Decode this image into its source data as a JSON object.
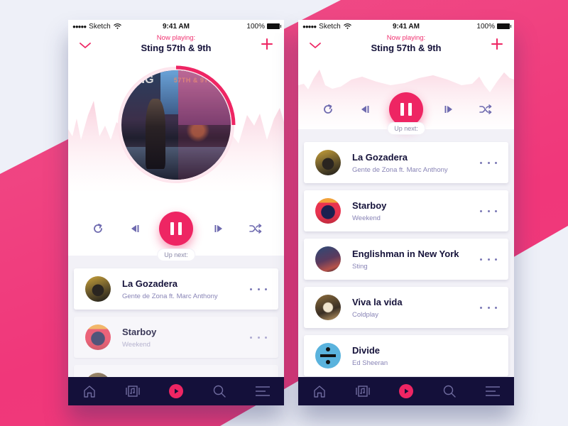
{
  "colors": {
    "accent": "#ee2563",
    "dark_nav": "#14103a",
    "title_text": "#15123a",
    "secondary_text": "#8884b6",
    "icon": "#7b78b5",
    "background_band": "#f0377a",
    "background": "#eef0f8"
  },
  "status_bar": {
    "carrier": "Sketch",
    "signal_dots": "●●●●●",
    "time": "9:41 AM",
    "battery": "100%"
  },
  "header": {
    "now_playing_label": "Now playing:",
    "track_title": "Sting 57th & 9th",
    "collapse_icon": "chevron-down-icon",
    "add_icon": "plus-icon"
  },
  "album_art": {
    "title_overlay": "57TH & 9TH",
    "name_overlay": "NG",
    "progress": 0.25
  },
  "controls": {
    "repeat_icon": "repeat-icon",
    "previous_icon": "skip-previous-icon",
    "play_pause_icon": "pause-icon",
    "next_icon": "skip-next-icon",
    "shuffle_icon": "shuffle-icon"
  },
  "up_next_label": "Up next:",
  "screen1": {
    "queue": [
      {
        "title": "La Gozadera",
        "artist": "Gente de Zona ft. Marc Anthony"
      },
      {
        "title": "Starboy",
        "artist": "Weekend"
      },
      {
        "title": "",
        "artist": ""
      }
    ]
  },
  "screen2": {
    "queue": [
      {
        "title": "La Gozadera",
        "artist": "Gente de Zona ft. Marc Anthony"
      },
      {
        "title": "Starboy",
        "artist": "Weekend"
      },
      {
        "title": "Englishman in New York",
        "artist": "Sting"
      },
      {
        "title": "Viva la vida",
        "artist": "Coldplay"
      },
      {
        "title": "Divide",
        "artist": "Ed Sheeran"
      }
    ]
  },
  "tabbar": [
    {
      "name": "home",
      "icon": "home-icon"
    },
    {
      "name": "library",
      "icon": "music-library-icon"
    },
    {
      "name": "now-playing",
      "icon": "play-icon",
      "active": true
    },
    {
      "name": "search",
      "icon": "search-icon"
    },
    {
      "name": "menu",
      "icon": "menu-icon"
    }
  ]
}
